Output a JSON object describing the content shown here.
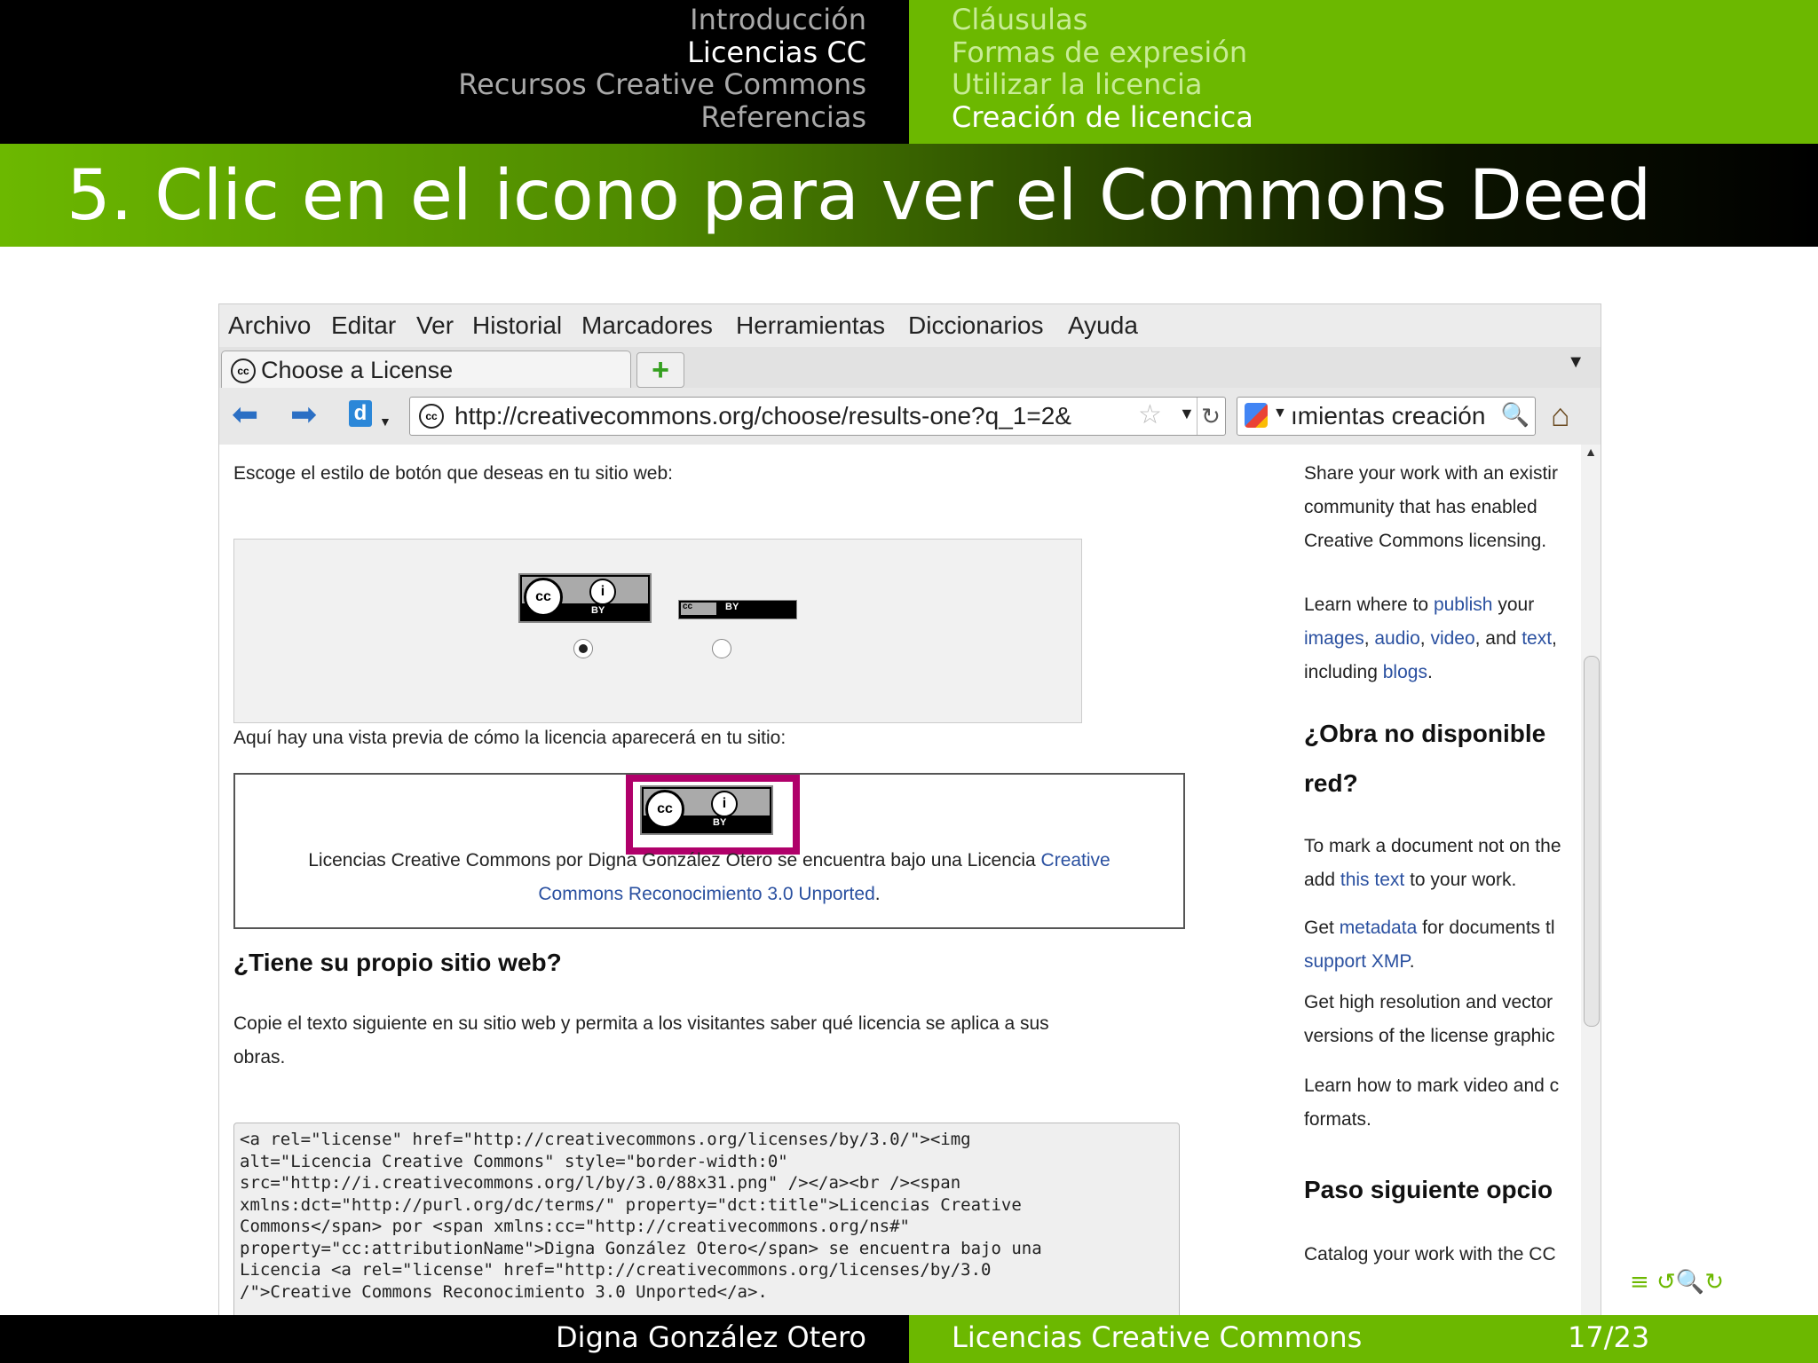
{
  "header": {
    "sections_left": [
      "Introducción",
      "Licencias CC",
      "Recursos Creative Commons",
      "Referencias"
    ],
    "current_left": 1,
    "sections_right": [
      "Cláusulas",
      "Formas de expresión",
      "Utilizar la licencia",
      "Creación de licencica"
    ],
    "current_right": 3
  },
  "frame_title": "5. Clic en el icono para ver el Commons Deed",
  "browser": {
    "menu": [
      "Archivo",
      "Editar",
      "Ver",
      "Historial",
      "Marcadores",
      "Herramientas",
      "Diccionarios",
      "Ayuda"
    ],
    "tab_title": "Choose a License",
    "new_tab_label": "+",
    "tab_list_icon": "chevron-down-icon",
    "url": "http://creativecommons.org/choose/results-one?q_1=2&",
    "search_text": "ımientas creación",
    "icons": {
      "back": "back-arrow-icon",
      "forward": "forward-arrow-icon",
      "delicious": "delicious-icon",
      "star": "bookmark-star-icon",
      "reload": "reload-icon",
      "search_go": "binoculars-icon",
      "home": "home-icon"
    }
  },
  "page": {
    "button_style_prompt": "Escoge el estilo de botón que deseas en tu sitio web:",
    "badge_cc": "cc",
    "badge_by_icon": "i",
    "badge_by_label": "BY",
    "selected_button": 1,
    "preview_prompt": "Aquí hay una vista previa de cómo la licencia aparecerá en tu sitio:",
    "preview_text_1": "Licencias Creative Commons por Digna González Otero se encuentra bajo una Licencia ",
    "preview_link_1": "Creative",
    "preview_link_2": "Commons Reconocimiento 3.0 Unported",
    "preview_text_2": ".",
    "own_site_heading": "¿Tiene su propio sitio web?",
    "copy_text_1": "Copie el texto siguiente en su sitio web y permita a los visitantes saber qué licencia se aplica a sus",
    "copy_text_2": "obras.",
    "code_lines": [
      "<a rel=\"license\" href=\"http://creativecommons.org/licenses/by/3.0/\"><img",
      "alt=\"Licencia Creative Commons\" style=\"border-width:0\"",
      "src=\"http://i.creativecommons.org/l/by/3.0/88x31.png\" /></a><br /><span",
      "xmlns:dct=\"http://purl.org/dc/terms/\" property=\"dct:title\">Licencias Creative",
      "Commons</span> por <span xmlns:cc=\"http://creativecommons.org/ns#\"",
      "property=\"cc:attributionName\">Digna González Otero</span> se encuentra bajo una",
      "Licencia <a rel=\"license\" href=\"http://creativecommons.org/licenses/by/3.0",
      "/\">Creative Commons Reconocimiento 3.0 Unported</a>."
    ]
  },
  "sidebar": {
    "share_1": "Share your work with an existir",
    "share_2": "community that has enabled",
    "share_3": "Creative Commons licensing.",
    "learn_1a": "Learn where to ",
    "learn_1b": "publish",
    "learn_1c": " your",
    "learn_2a": "images",
    "learn_2b": ", ",
    "learn_2c": "audio",
    "learn_2d": ", ",
    "learn_2e": "video",
    "learn_2f": ", and ",
    "learn_2g": "text",
    "learn_2h": ",",
    "learn_3a": "including ",
    "learn_3b": "blogs",
    "learn_3c": ".",
    "obra_h1": "¿Obra no disponible",
    "obra_h2": "red?",
    "mark_1": "To mark a document not on the",
    "mark_2a": "add ",
    "mark_2b": "this text",
    "mark_2c": " to your work.",
    "meta_1a": "Get ",
    "meta_1b": "metadata",
    "meta_1c": " for documents tl",
    "meta_2a": "support XMP",
    "meta_2b": ".",
    "hires_1": "Get high resolution and vector",
    "hires_2": "versions of the license graphic",
    "video_1": "Learn how to mark video and c",
    "video_2": "formats.",
    "next_h": "Paso siguiente opcio",
    "catalog": "Catalog your work with the CC"
  },
  "footer": {
    "author": "Digna González Otero",
    "title": "Licencias Creative Commons",
    "page": "17/23"
  },
  "beamer_nav": "≡  ↺🔍↻",
  "colors": {
    "accent": "#6cb800",
    "link": "#2a50a0",
    "highlight": "#b0006a"
  }
}
